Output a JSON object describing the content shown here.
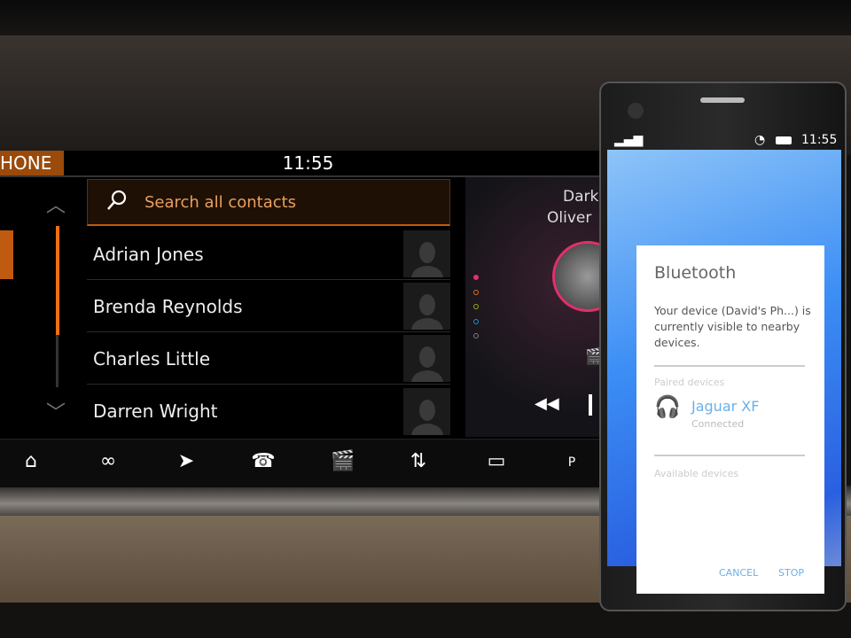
{
  "car_screen": {
    "tab_label": "HONE",
    "clock": "11:55",
    "search_placeholder": "Search all contacts",
    "contacts": [
      "Adrian Jones",
      "Brenda Reynolds",
      "Charles Little",
      "Darren Wright"
    ],
    "media": {
      "title": "Dark",
      "artist": "Oliver"
    },
    "page_dot_colors": [
      "#e0306a",
      "#e07020",
      "#90b020",
      "#2090d0",
      "#808080"
    ],
    "nav_icons": [
      "home-icon",
      "apps-icon",
      "navigation-icon",
      "phone-icon",
      "media-icon",
      "climate-icon",
      "camera-icon",
      "parking-icon"
    ]
  },
  "phone": {
    "status_time": "11:55",
    "dialog": {
      "title": "Bluetooth",
      "message": "Your device (David's Ph...) is currently visible to nearby devices.",
      "paired_label": "Paired devices",
      "device_name": "Jaguar XF",
      "device_status": "Connected",
      "available_label": "Available devices",
      "cancel": "CANCEL",
      "stop": "STOP"
    },
    "accent": "#4aa0e0"
  }
}
